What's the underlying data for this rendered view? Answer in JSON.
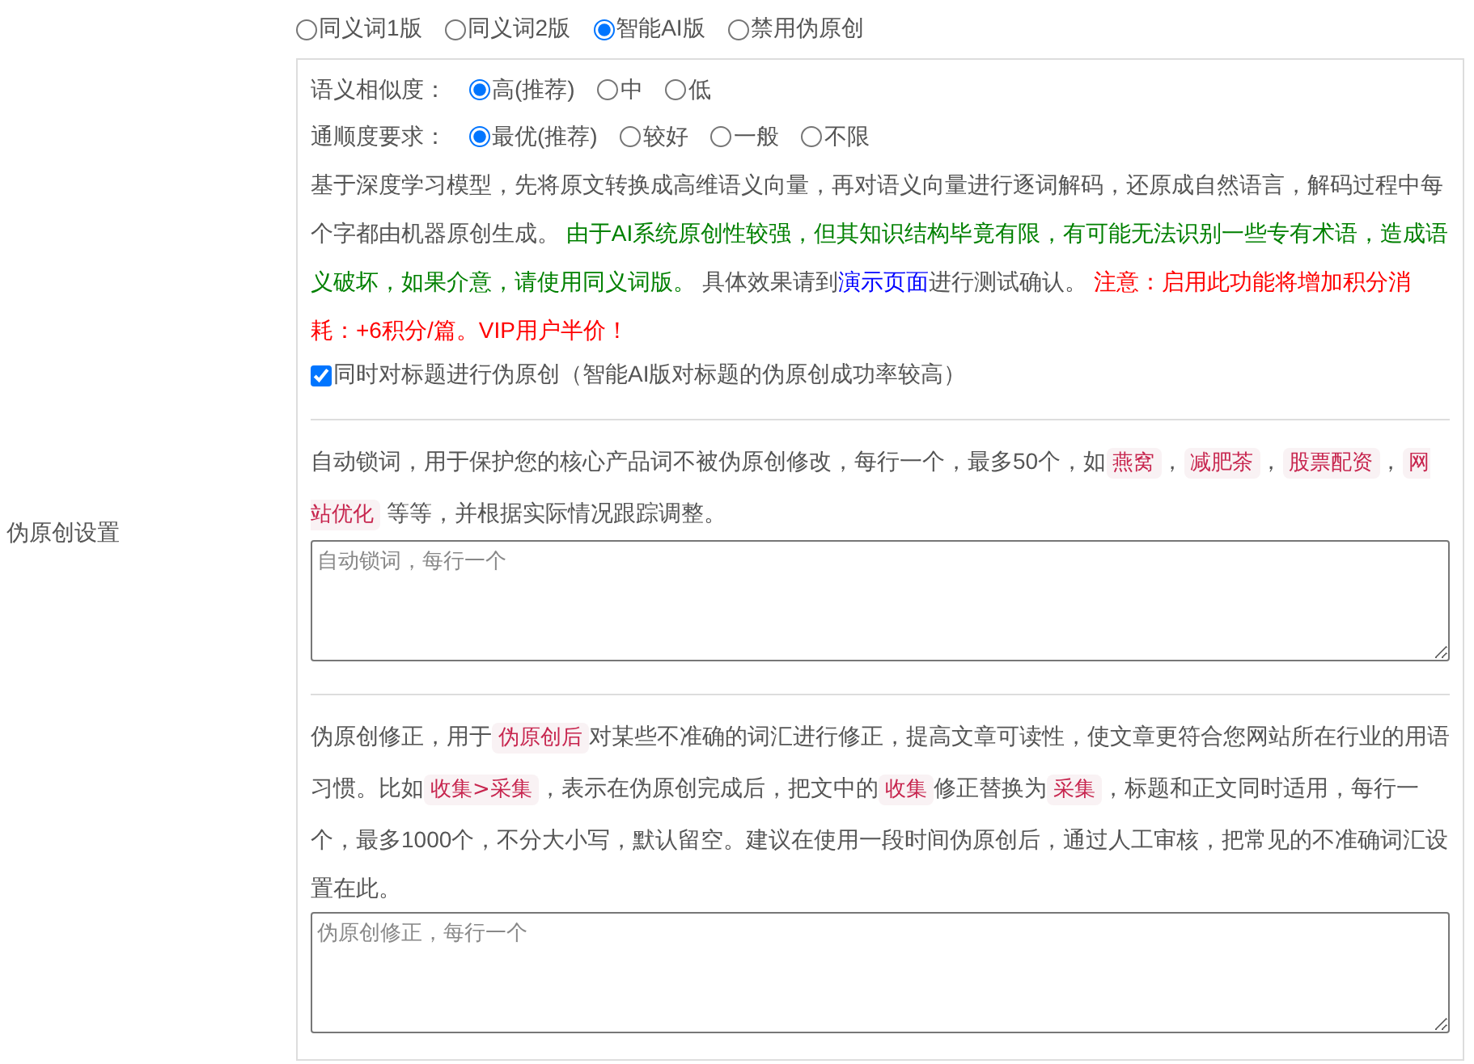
{
  "section_label": "伪原创设置",
  "modes": [
    {
      "label": "同义词1版",
      "selected": false
    },
    {
      "label": "同义词2版",
      "selected": false
    },
    {
      "label": "智能AI版",
      "selected": true
    },
    {
      "label": "禁用伪原创",
      "selected": false
    }
  ],
  "similarity": {
    "label": "语义相似度：",
    "options": [
      {
        "label": "高(推荐)",
        "selected": true
      },
      {
        "label": "中",
        "selected": false
      },
      {
        "label": "低",
        "selected": false
      }
    ]
  },
  "fluency": {
    "label": "通顺度要求：",
    "options": [
      {
        "label": "最优(推荐)",
        "selected": true
      },
      {
        "label": "较好",
        "selected": false
      },
      {
        "label": "一般",
        "selected": false
      },
      {
        "label": "不限",
        "selected": false
      }
    ]
  },
  "ai_description": [
    {
      "kind": "plain",
      "text": "基于深度学习模型，先将原文转换成高维语义向量，再对语义向量进行逐词解码，还原成自然语言，解码过程中每个字都由机器原创生成。 "
    },
    {
      "kind": "green",
      "text": "由于AI系统原创性较强，但其知识结构毕竟有限，有可能无法识别一些专有术语，造成语义破坏，如果介意，请使用同义词版。"
    },
    {
      "kind": "plain",
      "text": " 具体效果请到"
    },
    {
      "kind": "link",
      "text": "演示页面"
    },
    {
      "kind": "plain",
      "text": "进行测试确认。 "
    },
    {
      "kind": "red",
      "text": "注意：启用此功能将增加积分消耗：+6积分/篇。VIP用户半价！"
    }
  ],
  "title_option": {
    "label": "同时对标题进行伪原创（智能AI版对标题的伪原创成功率较高）",
    "checked": true
  },
  "lock_words": {
    "description": [
      {
        "kind": "plain",
        "text": "自动锁词，用于保护您的核心产品词不被伪原创修改，每行一个，最多50个，如"
      },
      {
        "kind": "code",
        "text": "燕窝"
      },
      {
        "kind": "plain",
        "text": "，"
      },
      {
        "kind": "code",
        "text": "减肥茶"
      },
      {
        "kind": "plain",
        "text": "，"
      },
      {
        "kind": "code",
        "text": "股票配资"
      },
      {
        "kind": "plain",
        "text": "，"
      },
      {
        "kind": "code",
        "text": "网站优化"
      },
      {
        "kind": "plain",
        "text": " 等等，并根据实际情况跟踪调整。"
      }
    ],
    "placeholder": "自动锁词，每行一个"
  },
  "corrections": {
    "description": [
      {
        "kind": "plain",
        "text": "伪原创修正，用于"
      },
      {
        "kind": "code",
        "text": "伪原创后"
      },
      {
        "kind": "plain",
        "text": "对某些不准确的词汇进行修正，提高文章可读性，使文章更符合您网站所在行业的用语习惯。比如"
      },
      {
        "kind": "code",
        "text": "收集>采集"
      },
      {
        "kind": "plain",
        "text": "，表示在伪原创完成后，把文中的"
      },
      {
        "kind": "code",
        "text": "收集"
      },
      {
        "kind": "plain",
        "text": "修正替换为"
      },
      {
        "kind": "code",
        "text": "采集"
      },
      {
        "kind": "plain",
        "text": "，标题和正文同时适用，每行一个，最多1000个，不分大小写，默认留空。建议在使用一段时间伪原创后，通过人工审核，把常见的不准确词汇设置在此。"
      }
    ],
    "placeholder": "伪原创修正，每行一个"
  }
}
